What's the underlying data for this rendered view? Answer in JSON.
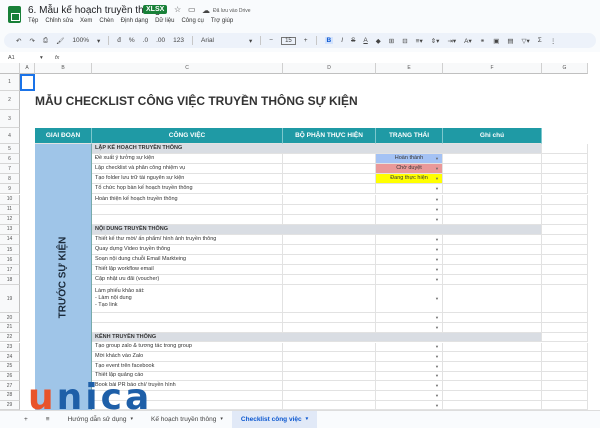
{
  "doc": {
    "title": "6. Mẫu kế hoạch truyền thông",
    "badge": "XLSX",
    "saved": "Đã lưu vào Drive"
  },
  "menu": [
    "Tệp",
    "Chỉnh sửa",
    "Xem",
    "Chèn",
    "Định dạng",
    "Dữ liệu",
    "Công cụ",
    "Trợ giúp"
  ],
  "toolbar": {
    "zoom": "100%",
    "currency": "đ",
    "percent": "%",
    "dec_less": ".0",
    "dec_more": ".00",
    "format": "123",
    "font": "Arial",
    "size": "15",
    "bold": "B"
  },
  "formula": {
    "cell": "A1",
    "fx": "fx"
  },
  "columns": [
    "A",
    "B",
    "C",
    "D",
    "E",
    "F",
    "G"
  ],
  "sheet_title": "MẪU CHECKLIST CÔNG VIỆC TRUYỀN THÔNG SỰ KIỆN",
  "headers": {
    "stage": "GIAI ĐOẠN",
    "task": "CÔNG VIỆC",
    "dept": "BỘ PHẬN THỰC HIỆN",
    "status": "TRẠNG THÁI",
    "note": "Ghi chú"
  },
  "stage": "TRƯỚC SỰ KIỆN",
  "rows": [
    {
      "n": "5",
      "type": "section",
      "text": "LẬP KẾ HOẠCH TRUYỀN THÔNG"
    },
    {
      "n": "6",
      "type": "task",
      "text": "Đề xuất ý tưởng sự kiện",
      "status": "Hoàn thành",
      "color": "#a4c2f4"
    },
    {
      "n": "7",
      "type": "task",
      "text": "Lập checklist và phân công nhiệm vụ",
      "status": "Chờ duyệt",
      "color": "#ea9999"
    },
    {
      "n": "8",
      "type": "task",
      "text": "Tạo folder lưu trữ tài nguyên sự kiện",
      "status": "Đang thực hiện",
      "color": "#ffff00"
    },
    {
      "n": "9",
      "type": "task",
      "text": "Tổ chức họp bàn kế hoạch truyền thông"
    },
    {
      "n": "10",
      "type": "task",
      "text": "Hoàn thiện kế hoạch truyền thông"
    },
    {
      "n": "11",
      "type": "task",
      "text": ""
    },
    {
      "n": "12",
      "type": "task",
      "text": ""
    },
    {
      "n": "13",
      "type": "section",
      "text": "NỘI DUNG TRUYỀN THÔNG"
    },
    {
      "n": "14",
      "type": "task",
      "text": "Thiết kế thư mời/ ấn phẩm/ hình ảnh truyền thông"
    },
    {
      "n": "15",
      "type": "task",
      "text": "Quay dựng Video truyền thông"
    },
    {
      "n": "16",
      "type": "task",
      "text": "Soạn nội dung chuỗi Email Markteing"
    },
    {
      "n": "17",
      "type": "task",
      "text": "Thiết lập workflow email"
    },
    {
      "n": "18",
      "type": "task",
      "text": "Cập nhật ưu đãi (voucher)"
    },
    {
      "n": "19",
      "type": "task",
      "text": "Làm phiếu khảo sát:\n- Làm nội dung\n- Tạo link",
      "tall": true
    },
    {
      "n": "20",
      "type": "task",
      "text": ""
    },
    {
      "n": "21",
      "type": "task",
      "text": ""
    },
    {
      "n": "22",
      "type": "section",
      "text": "KÊNH TRUYỀN THÔNG"
    },
    {
      "n": "23",
      "type": "task",
      "text": "Tạo group zalo & tương tác trong group"
    },
    {
      "n": "24",
      "type": "task",
      "text": "Mời khách vào Zalo"
    },
    {
      "n": "25",
      "type": "task",
      "text": "Tạo event trên facebook"
    },
    {
      "n": "26",
      "type": "task",
      "text": "Thiết lập quảng cáo"
    },
    {
      "n": "27",
      "type": "task",
      "text": "Book bài PR báo chí/ truyền hình"
    },
    {
      "n": "28",
      "type": "task",
      "text": ""
    },
    {
      "n": "29",
      "type": "task",
      "text": ""
    }
  ],
  "sheets": [
    {
      "label": "Hướng dẫn sử dụng"
    },
    {
      "label": "Kế hoạch truyền thông"
    },
    {
      "label": "Checklist công việc",
      "active": true
    }
  ],
  "watermark": "unica",
  "colors": {
    "header": "#1f9aa5",
    "stage": "#9fc5e8",
    "section": "#d9dde3"
  }
}
